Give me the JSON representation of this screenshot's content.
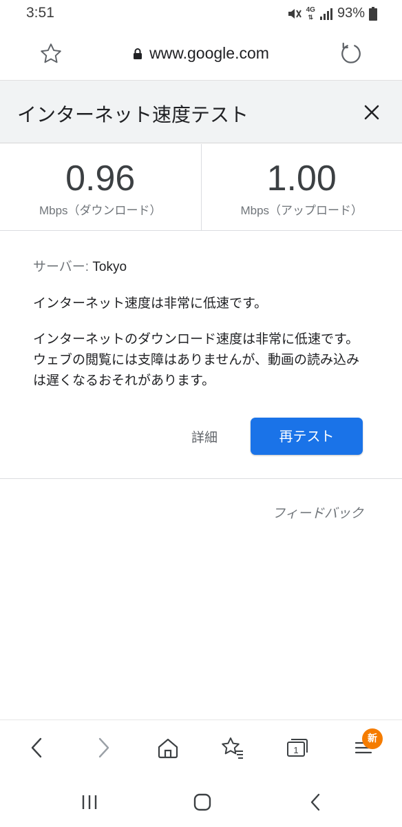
{
  "status": {
    "time": "3:51",
    "network": "4G",
    "battery": "93%"
  },
  "browser": {
    "url": "www.google.com"
  },
  "widget": {
    "title": "インターネット速度テスト",
    "download": {
      "value": "0.96",
      "label": "Mbps（ダウンロード）"
    },
    "upload": {
      "value": "1.00",
      "label": "Mbps（アップロード）"
    },
    "server_key": "サーバー:",
    "server_value": " Tokyo",
    "summary": "インターネット速度は非常に低速です。",
    "detail": "インターネットのダウンロード速度は非常に低速です。ウェブの閲覧には支障はありませんが、動画の読み込みは遅くなるおそれがあります。",
    "details_label": "詳細",
    "retest_label": "再テスト",
    "feedback_label": "フィードバック"
  },
  "toolbar": {
    "tab_count": "1",
    "badge": "新"
  },
  "colors": {
    "accent": "#1a73e8",
    "badge": "#f57c00"
  },
  "icons": [
    "star-icon",
    "lock-icon",
    "reload-icon",
    "close-icon",
    "back-icon",
    "forward-icon",
    "home-icon",
    "bookmarks-icon",
    "tabs-icon",
    "menu-icon",
    "recents-icon",
    "android-home-icon",
    "android-back-icon"
  ]
}
